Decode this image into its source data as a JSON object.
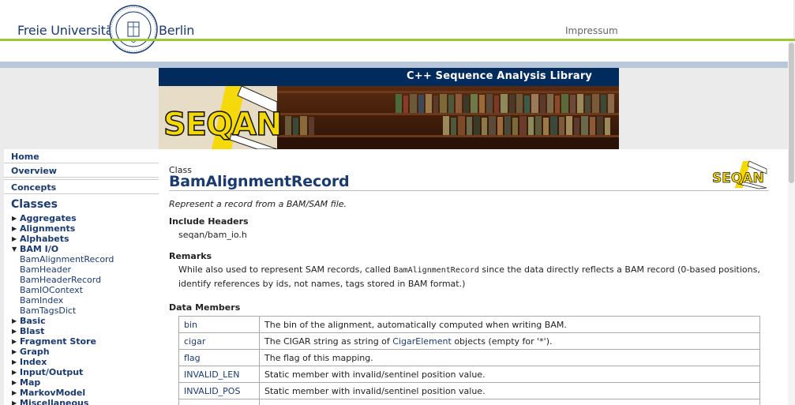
{
  "header": {
    "university_left": "Freie Universität",
    "university_right": "Berlin",
    "impressum": "Impressum"
  },
  "banner": {
    "title": "C++ Sequence Analysis Library",
    "logo_text": "SEQAN"
  },
  "sidebar": {
    "top_links": [
      "Home",
      "Overview",
      "Concepts"
    ],
    "classes_heading": "Classes",
    "categories_before": [
      "Aggregates",
      "Alignments",
      "Alphabets"
    ],
    "open_category": "BAM I/O",
    "open_items": [
      "BamAlignmentRecord",
      "BamHeader",
      "BamHeaderRecord",
      "BamIOContext",
      "BamIndex",
      "BamTagsDict"
    ],
    "categories_after": [
      "Basic",
      "Blast",
      "Fragment Store",
      "Graph",
      "Index",
      "Input/Output",
      "Map",
      "MarkovModel",
      "Miscellaneous"
    ]
  },
  "main": {
    "kind": "Class",
    "title": "BamAlignmentRecord",
    "brief": "Represent a record from a BAM/SAM file.",
    "include_heading": "Include Headers",
    "include_value": "seqan/bam_io.h",
    "remarks_heading": "Remarks",
    "remarks_pre": "While also used to represent SAM records, called ",
    "remarks_code": "BamAlignmentRecord",
    "remarks_post": " since the data directly reflects a BAM record (0-based positions, identify references by ids, not names, tags stored in BAM format.)",
    "data_members_heading": "Data Members",
    "members": [
      {
        "name": "bin",
        "desc": "The bin of the alignment, automatically computed when writing BAM."
      },
      {
        "name": "cigar",
        "desc_pre": "The CIGAR string as string of ",
        "desc_link": "CigarElement",
        "desc_post": " objects (empty for '*')."
      },
      {
        "name": "flag",
        "desc": "The flag of this mapping."
      },
      {
        "name": "INVALID_LEN",
        "desc": "Static member with invalid/sentinel position value."
      },
      {
        "name": "INVALID_POS",
        "desc": "Static member with invalid/sentinel position value."
      }
    ]
  },
  "colors": {
    "accent_green": "#9cc836",
    "navy": "#002b5c",
    "link": "#1b3a6e",
    "logo_yellow": "#f5d800"
  }
}
